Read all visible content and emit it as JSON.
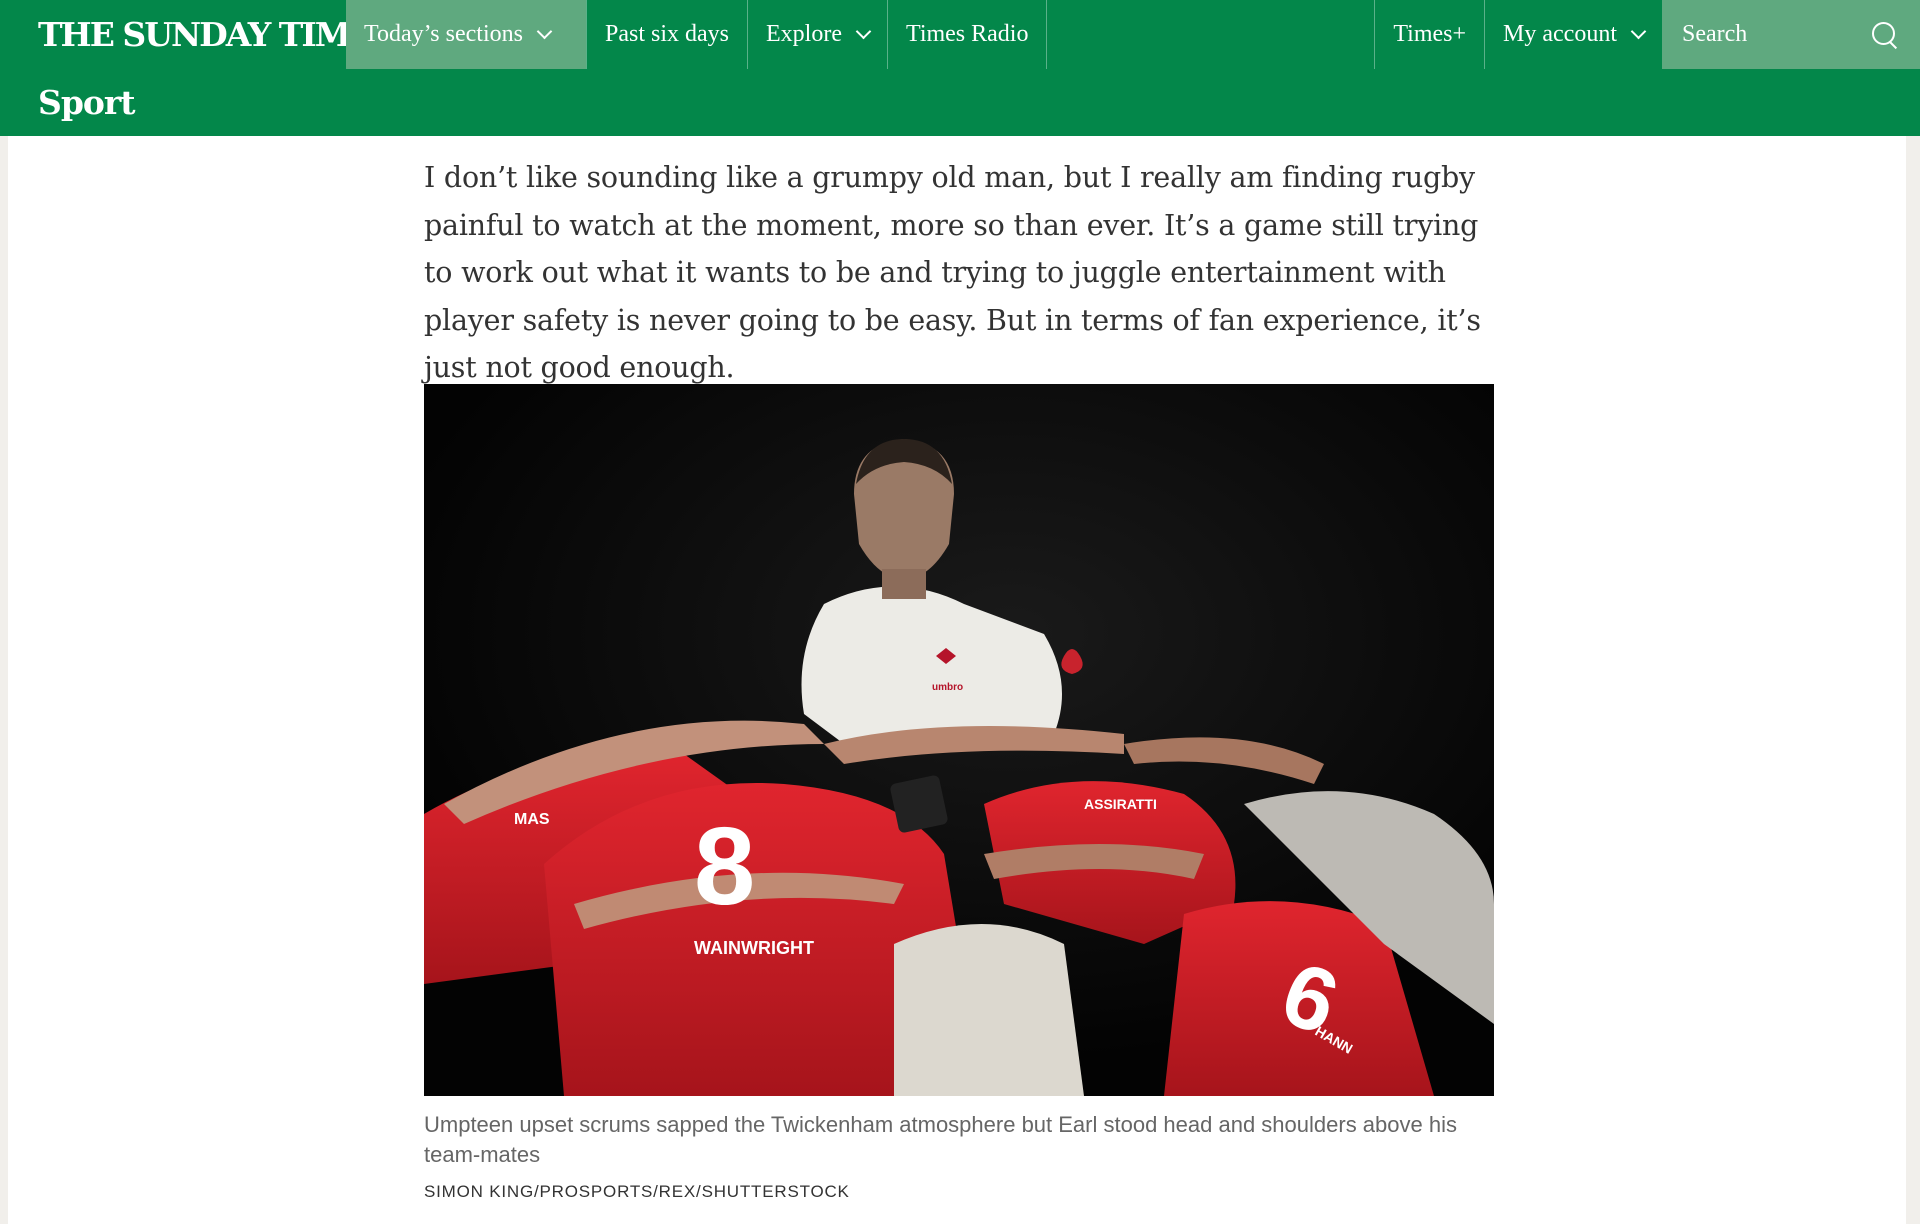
{
  "nav": {
    "logo": "THE SUNDAY TIMES",
    "todays_sections": "Today’s sections",
    "past_six_days": "Past six days",
    "explore": "Explore",
    "times_radio": "Times Radio",
    "times_plus": "Times+",
    "my_account": "My account",
    "search_placeholder": "Search"
  },
  "section": {
    "title": "Sport"
  },
  "article": {
    "paragraph": "I don’t like sounding like a grumpy old man, but I really am finding rugby painful to watch at the moment, more so than ever. It’s a game still trying to work out what it wants to be and trying to juggle entertainment with player safety is never going to be easy. But in terms of fan experience, it’s just not good enough.",
    "figure": {
      "caption": "Umpteen upset scrums sapped the Twickenham atmosphere but Earl stood head and shoulders above his team-mates",
      "credit": "SIMON KING/PROSPORTS/REX/SHUTTERSTOCK",
      "jersey_numbers": [
        "8",
        "6"
      ],
      "shirt_names": [
        "MAS",
        "ASSIRATTI",
        "WAINWRIGHT",
        "HANN"
      ],
      "kit_brand": "umbro"
    }
  },
  "colors": {
    "brand_green": "#03874a",
    "nav_active": "#5fa97f",
    "jersey_red": "#d9222b",
    "jersey_white": "#ecebe6"
  },
  "icons": {
    "chevron": "chevron-down-icon",
    "search": "search-icon"
  }
}
